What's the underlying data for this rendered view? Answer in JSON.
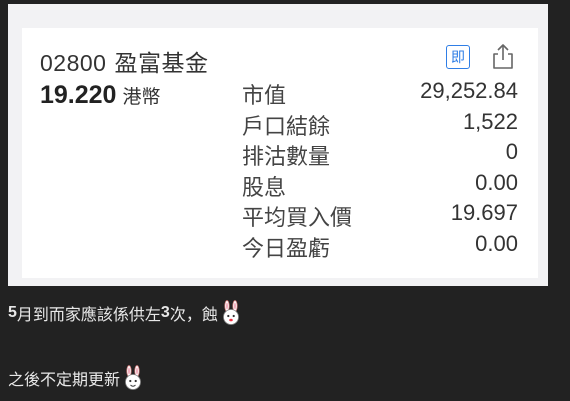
{
  "quote_card": {
    "code": "02800",
    "name": "盈富基金",
    "price": "19.220",
    "currency": "港幣",
    "realtime_label": "即",
    "rows": [
      {
        "label": "市值",
        "value": "29,252.84"
      },
      {
        "label": "戶口結餘",
        "value": "1,522"
      },
      {
        "label": "排沽數量",
        "value": "0"
      },
      {
        "label": "股息",
        "value": "0.00"
      },
      {
        "label": "平均買入價",
        "value": "19.697"
      },
      {
        "label": "今日盈虧",
        "value": "0.00"
      }
    ]
  },
  "post": {
    "line1_bold": "5",
    "line1_text": "月到而家應該係供左",
    "line1_bold2": "3",
    "line1_text2": "次，蝕",
    "line2_text": "之後不定期更新"
  },
  "icons": {
    "realtime": "realtime-badge-icon",
    "share": "share-icon",
    "emoticon": "rabbit-emoticon-icon"
  },
  "colors": {
    "accent": "#2f7ee6",
    "page_bg": "#222222",
    "card_bg": "#ffffff"
  }
}
